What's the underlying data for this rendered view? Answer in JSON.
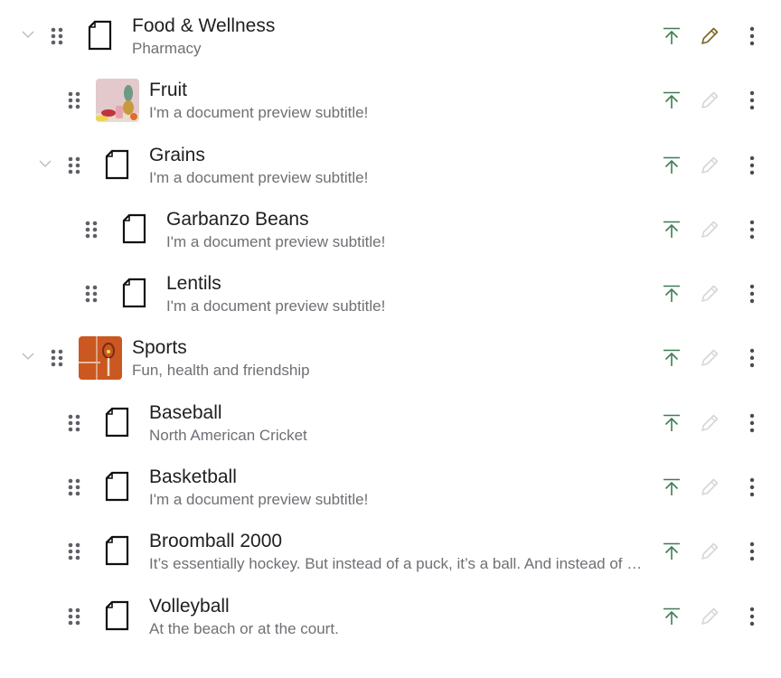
{
  "colors": {
    "accent_green": "#3f7d54",
    "edit_active": "#7a6420",
    "edit_disabled": "#d6d6d6",
    "title_text": "#1f1f1f",
    "subtitle_text": "#6f6f75",
    "handle": "#5f5f66"
  },
  "items": [
    {
      "title": "Food & Wellness",
      "subtitle": "Pharmacy",
      "level": 0,
      "expandable": true,
      "expanded": true,
      "icon": "document-icon",
      "edit_enabled": true
    },
    {
      "title": "Fruit",
      "subtitle": "I'm a document preview subtitle!",
      "level": 1,
      "expandable": false,
      "icon": "fruit-thumbnail",
      "edit_enabled": false
    },
    {
      "title": "Grains",
      "subtitle": "I'm a document preview subtitle!",
      "level": 1,
      "expandable": true,
      "expanded": true,
      "icon": "document-icon",
      "edit_enabled": false
    },
    {
      "title": "Garbanzo Beans",
      "subtitle": "I'm a document preview subtitle!",
      "level": 2,
      "expandable": false,
      "icon": "document-icon",
      "edit_enabled": false
    },
    {
      "title": "Lentils",
      "subtitle": "I'm a document preview subtitle!",
      "level": 2,
      "expandable": false,
      "icon": "document-icon",
      "edit_enabled": false
    },
    {
      "title": "Sports",
      "subtitle": "Fun, health and friendship",
      "level": 0,
      "expandable": true,
      "expanded": true,
      "icon": "sports-thumbnail",
      "edit_enabled": false
    },
    {
      "title": "Baseball",
      "subtitle": "North American Cricket",
      "level": 1,
      "expandable": false,
      "icon": "document-icon",
      "edit_enabled": false
    },
    {
      "title": "Basketball",
      "subtitle": "I'm a document preview subtitle!",
      "level": 1,
      "expandable": false,
      "icon": "document-icon",
      "edit_enabled": false
    },
    {
      "title": "Broomball 2000",
      "subtitle": "It’s essentially hockey. But instead of a puck, it’s a ball. And instead of a stick, it’s a broom.",
      "level": 1,
      "expandable": false,
      "icon": "document-icon",
      "edit_enabled": false
    },
    {
      "title": "Volleyball",
      "subtitle": "At the beach or at the court.",
      "level": 1,
      "expandable": false,
      "icon": "document-icon",
      "edit_enabled": false
    }
  ]
}
